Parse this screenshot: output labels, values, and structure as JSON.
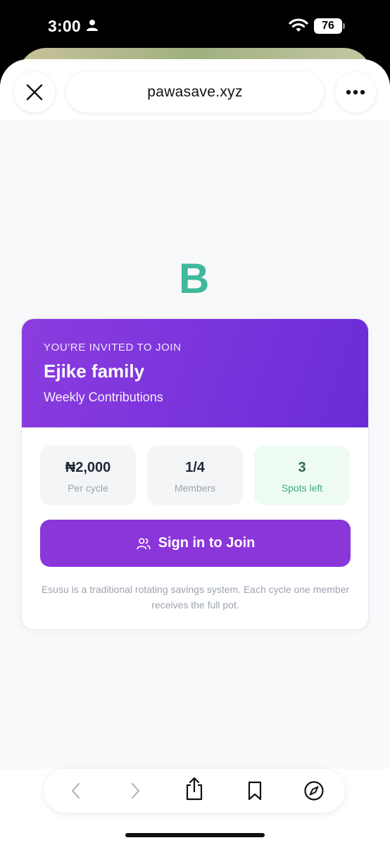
{
  "status_bar": {
    "time": "3:00",
    "battery": "76"
  },
  "browser": {
    "url": "pawasave.xyz"
  },
  "page": {
    "logo_letter": "B",
    "invite": {
      "eyebrow": "YOU'RE INVITED TO JOIN",
      "group_name": "Ejike family",
      "group_type": "Weekly Contributions"
    },
    "stats": [
      {
        "value": "₦2,000",
        "label": "Per cycle"
      },
      {
        "value": "1/4",
        "label": "Members"
      },
      {
        "value": "3",
        "label": "Spots left"
      }
    ],
    "join_button_label": "Sign in to Join",
    "footnote": "Esusu is a traditional rotating savings system. Each cycle one member receives the full pot."
  },
  "colors": {
    "brand_green": "#3fb89b",
    "header_purple": "#8b3ddf",
    "button_purple": "#8a36d9",
    "spots_bg": "#eefbf3"
  },
  "icons": {
    "close": "close-icon",
    "more": "more-icon",
    "back": "back-icon",
    "forward": "forward-icon",
    "share": "share-icon",
    "bookmarks": "bookmarks-icon",
    "safari": "compass-icon",
    "join": "users-icon"
  }
}
